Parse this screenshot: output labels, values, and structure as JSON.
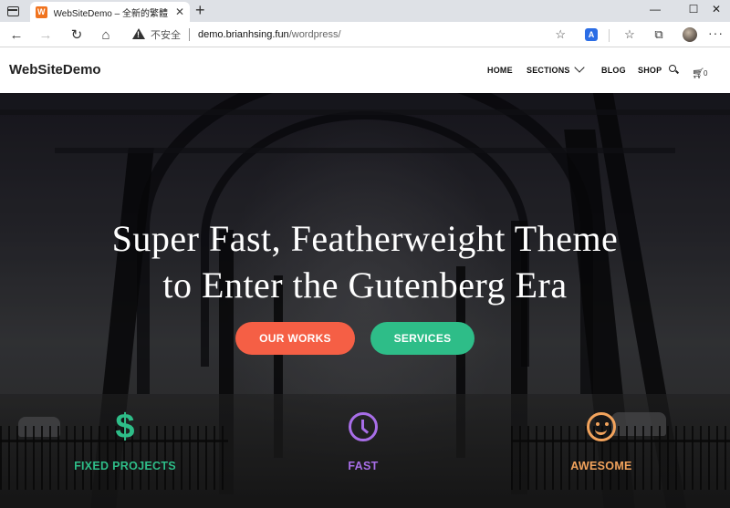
{
  "browser": {
    "tab": {
      "title": "WebSiteDemo – 全新的繁體中文",
      "favicon_text": "W"
    },
    "address_bar": {
      "security_label": "不安全",
      "url_host": "demo.brianhsing.fun",
      "url_path": "/wordpress/"
    },
    "controls": {
      "minimize": "—",
      "maximize": "☐",
      "close": "✕"
    }
  },
  "site": {
    "logo": "WebSiteDemo",
    "menu": {
      "home": "HOME",
      "sections": "SECTIONS",
      "blog": "BLOG",
      "shop": "SHOP"
    },
    "cart_count": "0"
  },
  "hero": {
    "title_line1": "Super Fast, Featherweight Theme",
    "title_line2": "to Enter the Gutenberg Era",
    "buttons": {
      "primary": "OUR WORKS",
      "secondary": "SERVICES"
    }
  },
  "features": [
    {
      "label": "FIXED PROJECTS",
      "icon": "dollar-icon",
      "color": "#2ebd88"
    },
    {
      "label": "FAST",
      "icon": "clock-icon",
      "color": "#a86ee8"
    },
    {
      "label": "AWESOME",
      "icon": "smile-icon",
      "color": "#f2a35c"
    }
  ],
  "colors": {
    "accent_red": "#f55f45",
    "accent_green": "#2ebd88"
  }
}
